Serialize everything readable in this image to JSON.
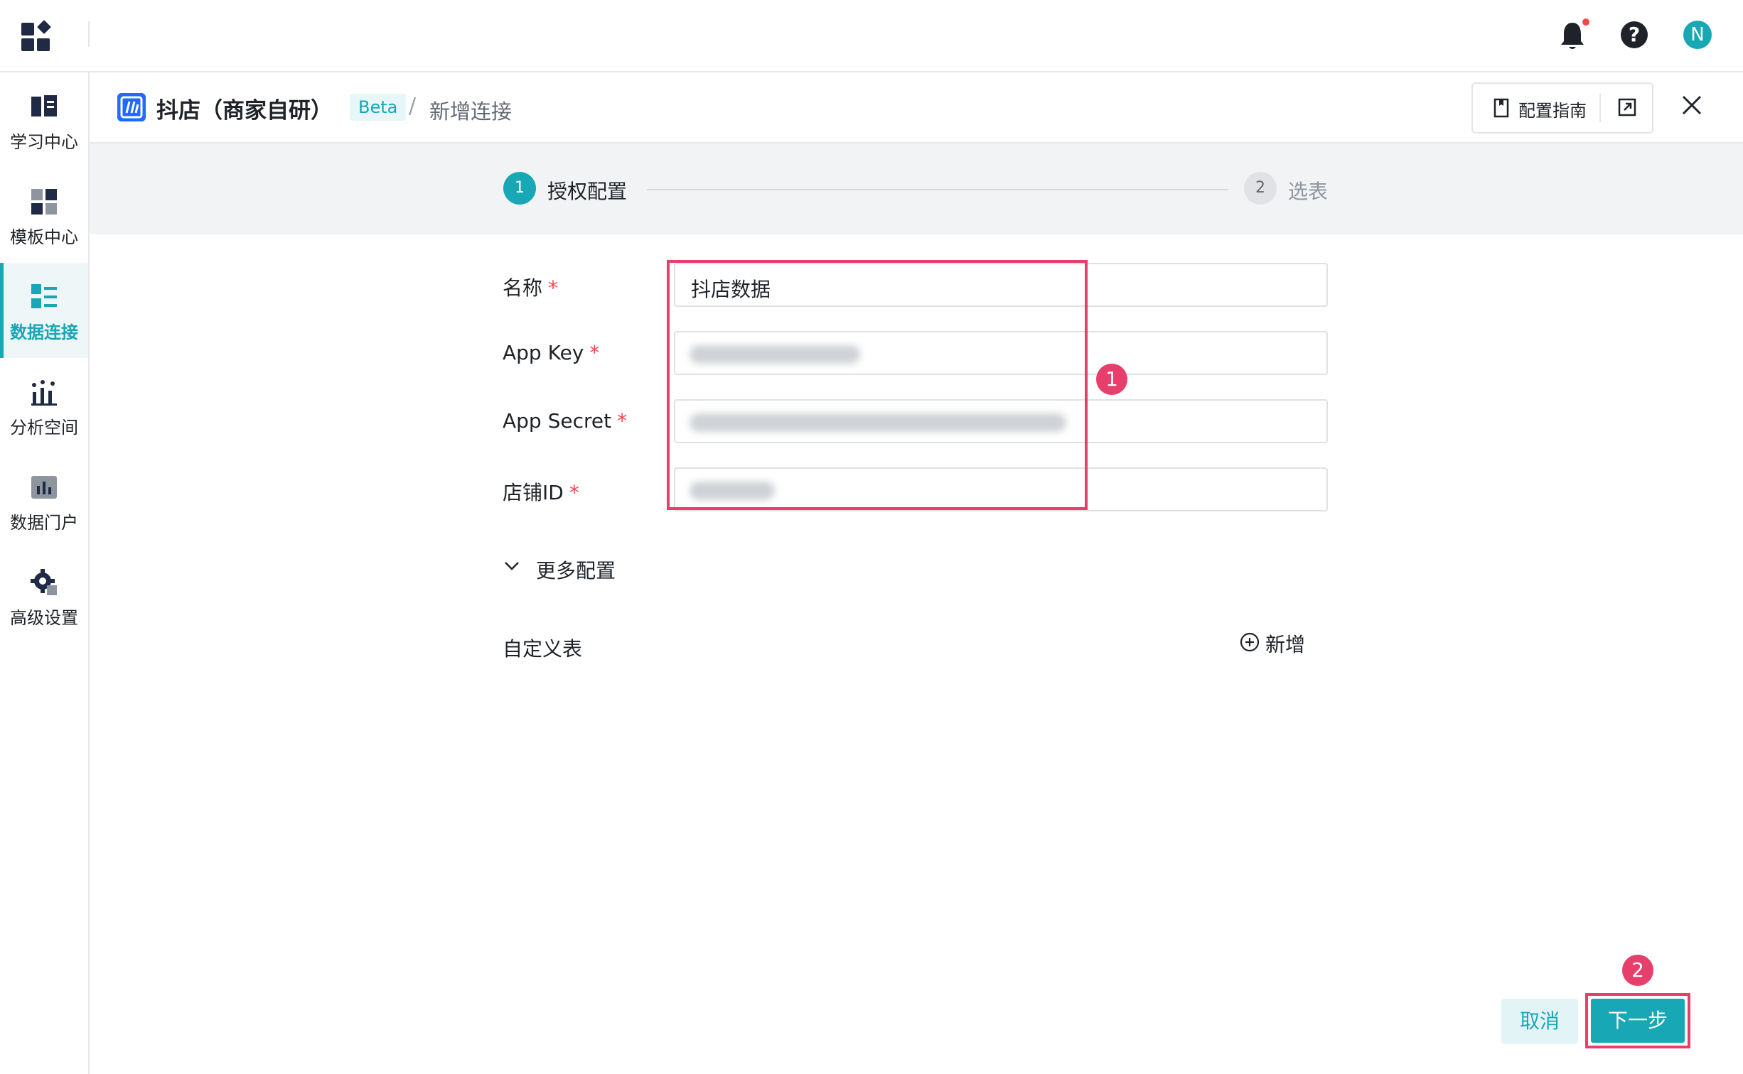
{
  "topbar": {
    "notification_dot_color": "#f5474b",
    "help_glyph": "?",
    "avatar_initial": "N"
  },
  "sidebar": {
    "items": [
      {
        "label": "学习中心",
        "icon": "book-icon",
        "active": false
      },
      {
        "label": "模板中心",
        "icon": "template-icon",
        "active": false
      },
      {
        "label": "数据连接",
        "icon": "data-connect-icon",
        "active": true
      },
      {
        "label": "分析空间",
        "icon": "analysis-icon",
        "active": false
      },
      {
        "label": "数据门户",
        "icon": "portal-icon",
        "active": false
      },
      {
        "label": "高级设置",
        "icon": "gear-icon",
        "active": false
      }
    ]
  },
  "header": {
    "title": "抖店（商家自研）",
    "badge": "Beta",
    "separator": "/",
    "page": "新增连接",
    "guide_label": "配置指南"
  },
  "steps": [
    {
      "number": "1",
      "label": "授权配置",
      "active": true
    },
    {
      "number": "2",
      "label": "选表",
      "active": false
    }
  ],
  "form": {
    "fields": [
      {
        "label": "名称",
        "value": "抖店数据",
        "required_mark": "*"
      },
      {
        "label": "App Key",
        "value": "",
        "required_mark": "*"
      },
      {
        "label": "App Secret",
        "value": "",
        "required_mark": "*"
      },
      {
        "label": "店铺ID",
        "value": "",
        "required_mark": "*"
      }
    ],
    "more_config": "更多配置",
    "custom_table": "自定义表",
    "add_label": "新增"
  },
  "annotations": {
    "badge1": "1",
    "badge2": "2",
    "color": "#e83e6c"
  },
  "footer": {
    "cancel": "取消",
    "next": "下一步"
  },
  "colors": {
    "accent": "#17a7b5",
    "brand_blue": "#1f6bff"
  }
}
